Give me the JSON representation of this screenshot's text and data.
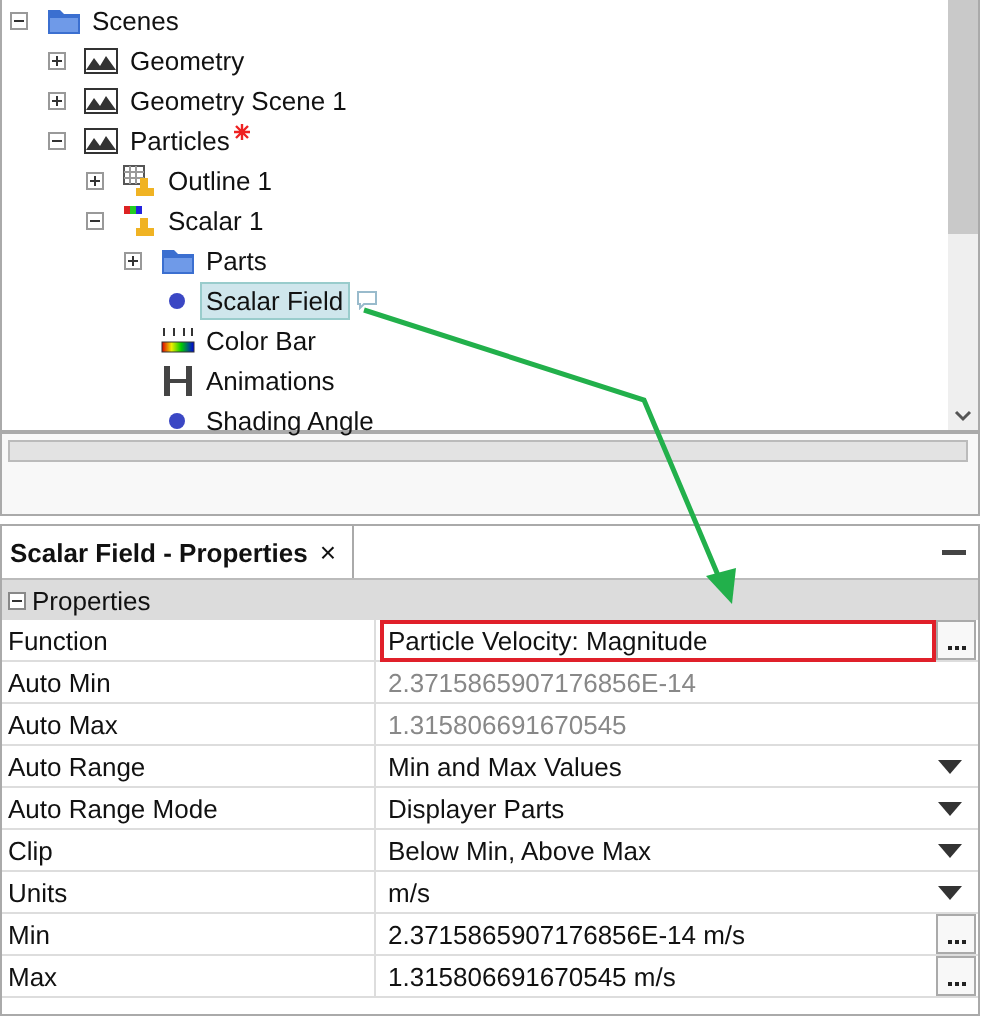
{
  "tree": {
    "items": [
      {
        "label": "Scenes",
        "kind": "folder",
        "expanded": true,
        "selected": false,
        "modified": false,
        "note": false,
        "children": [
          {
            "label": "Geometry",
            "kind": "scene",
            "expanded": false,
            "selected": false,
            "modified": false,
            "note": false
          },
          {
            "label": "Geometry Scene 1",
            "kind": "scene",
            "expanded": false,
            "selected": false,
            "modified": false,
            "note": false
          },
          {
            "label": "Particles",
            "kind": "scene",
            "expanded": true,
            "selected": false,
            "modified": true,
            "note": false,
            "children": [
              {
                "label": "Outline 1",
                "kind": "outline",
                "expanded": false,
                "selected": false,
                "modified": false,
                "note": false
              },
              {
                "label": "Scalar 1",
                "kind": "scalar",
                "expanded": true,
                "selected": false,
                "modified": false,
                "note": false,
                "children": [
                  {
                    "label": "Parts",
                    "kind": "folder",
                    "expanded": false,
                    "selected": false,
                    "modified": false,
                    "note": false
                  },
                  {
                    "label": "Scalar Field",
                    "kind": "dot",
                    "selected": true,
                    "modified": false,
                    "note": true
                  },
                  {
                    "label": "Color Bar",
                    "kind": "colorbar",
                    "selected": false,
                    "modified": false,
                    "note": false
                  },
                  {
                    "label": "Animations",
                    "kind": "film",
                    "selected": false,
                    "modified": false,
                    "note": false
                  },
                  {
                    "label": "Shading Angle",
                    "kind": "dot",
                    "selected": false,
                    "modified": false,
                    "note": false
                  }
                ]
              }
            ]
          }
        ]
      }
    ]
  },
  "properties": {
    "tab": {
      "label": "Scalar Field - Properties",
      "close": "×"
    },
    "group": {
      "label": "Properties",
      "expanded": true
    },
    "rows": [
      {
        "name": "Function",
        "value": "Particle Velocity: Magnitude",
        "kind": "button",
        "disabled": false,
        "highlighted": true
      },
      {
        "name": "Auto Min",
        "value": "2.3715865907176856E-14",
        "kind": "text",
        "disabled": true,
        "highlighted": false
      },
      {
        "name": "Auto Max",
        "value": "1.315806691670545",
        "kind": "text",
        "disabled": true,
        "highlighted": false
      },
      {
        "name": "Auto Range",
        "value": "Min and Max Values",
        "kind": "dropdown",
        "disabled": false,
        "highlighted": false
      },
      {
        "name": "Auto Range Mode",
        "value": "Displayer Parts",
        "kind": "dropdown",
        "disabled": false,
        "highlighted": false
      },
      {
        "name": "Clip",
        "value": "Below Min, Above Max",
        "kind": "dropdown",
        "disabled": false,
        "highlighted": false
      },
      {
        "name": "Units",
        "value": "m/s",
        "kind": "dropdown",
        "disabled": false,
        "highlighted": false
      },
      {
        "name": "Min",
        "value": "2.3715865907176856E-14 m/s",
        "kind": "button",
        "disabled": false,
        "highlighted": false
      },
      {
        "name": "Max",
        "value": "1.315806691670545 m/s",
        "kind": "button",
        "disabled": false,
        "highlighted": false
      }
    ]
  }
}
